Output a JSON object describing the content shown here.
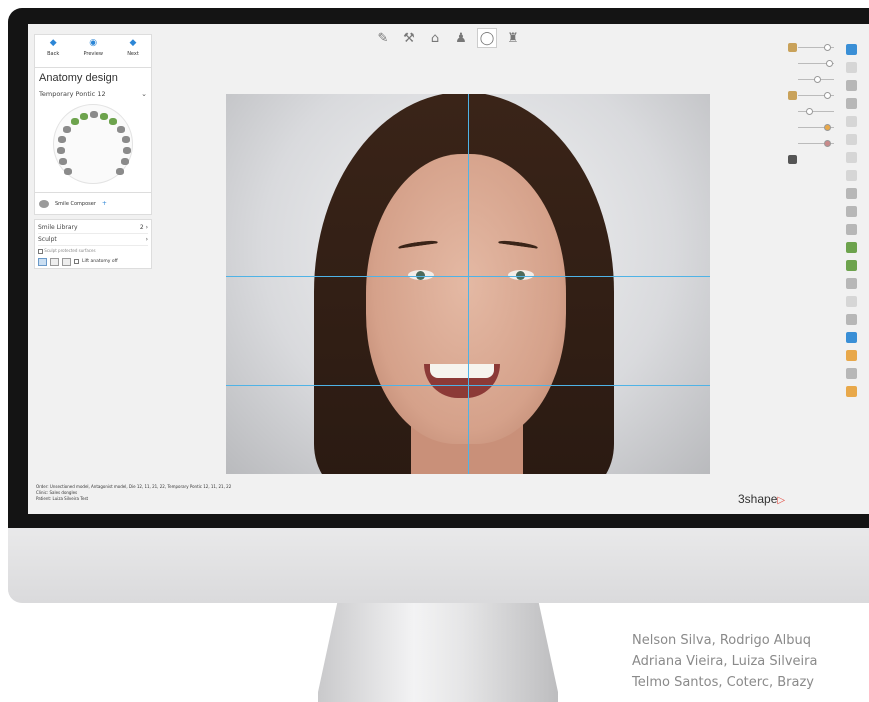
{
  "nav": {
    "back": "Back",
    "preview": "Preview",
    "next": "Next"
  },
  "panel": {
    "title": "Anatomy design",
    "selector": "Temporary Pontic 12",
    "composer": "Smile Composer",
    "library": {
      "label": "Smile Library",
      "value": "2"
    },
    "sculpt": "Sculpt",
    "sculpt_protected": "Sculpt protected surfaces",
    "lift_anatomy": "Lift anatomy off"
  },
  "status": {
    "order": "Order:    Unsectioned model, Antagonist model, Die 12, 11, 21, 22, Temporary Pontic 12, 11, 21, 22",
    "clinic": "Clinic:    Sales dongles",
    "patient": "Patient:   Luiza Silveira Test"
  },
  "logo": "3shape",
  "credit": [
    "Nelson Silva, Rodrigo Albuq",
    "Adriana Vieira, Luiza Silveira",
    "Telmo Santos, Coterc, Brazy"
  ],
  "colors": {
    "accent": "#2c86d6",
    "guide_lines": "#4fb3e6",
    "logo_mark": "#e2463c"
  },
  "icons": {
    "toolbar": [
      "pen-icon",
      "tools-icon",
      "teeth-icon",
      "user-icon",
      "tooth-icon",
      "cup-icon"
    ],
    "right": [
      "window-icon",
      "fullscreen-icon",
      "swap-icon",
      "camera-icon"
    ]
  }
}
